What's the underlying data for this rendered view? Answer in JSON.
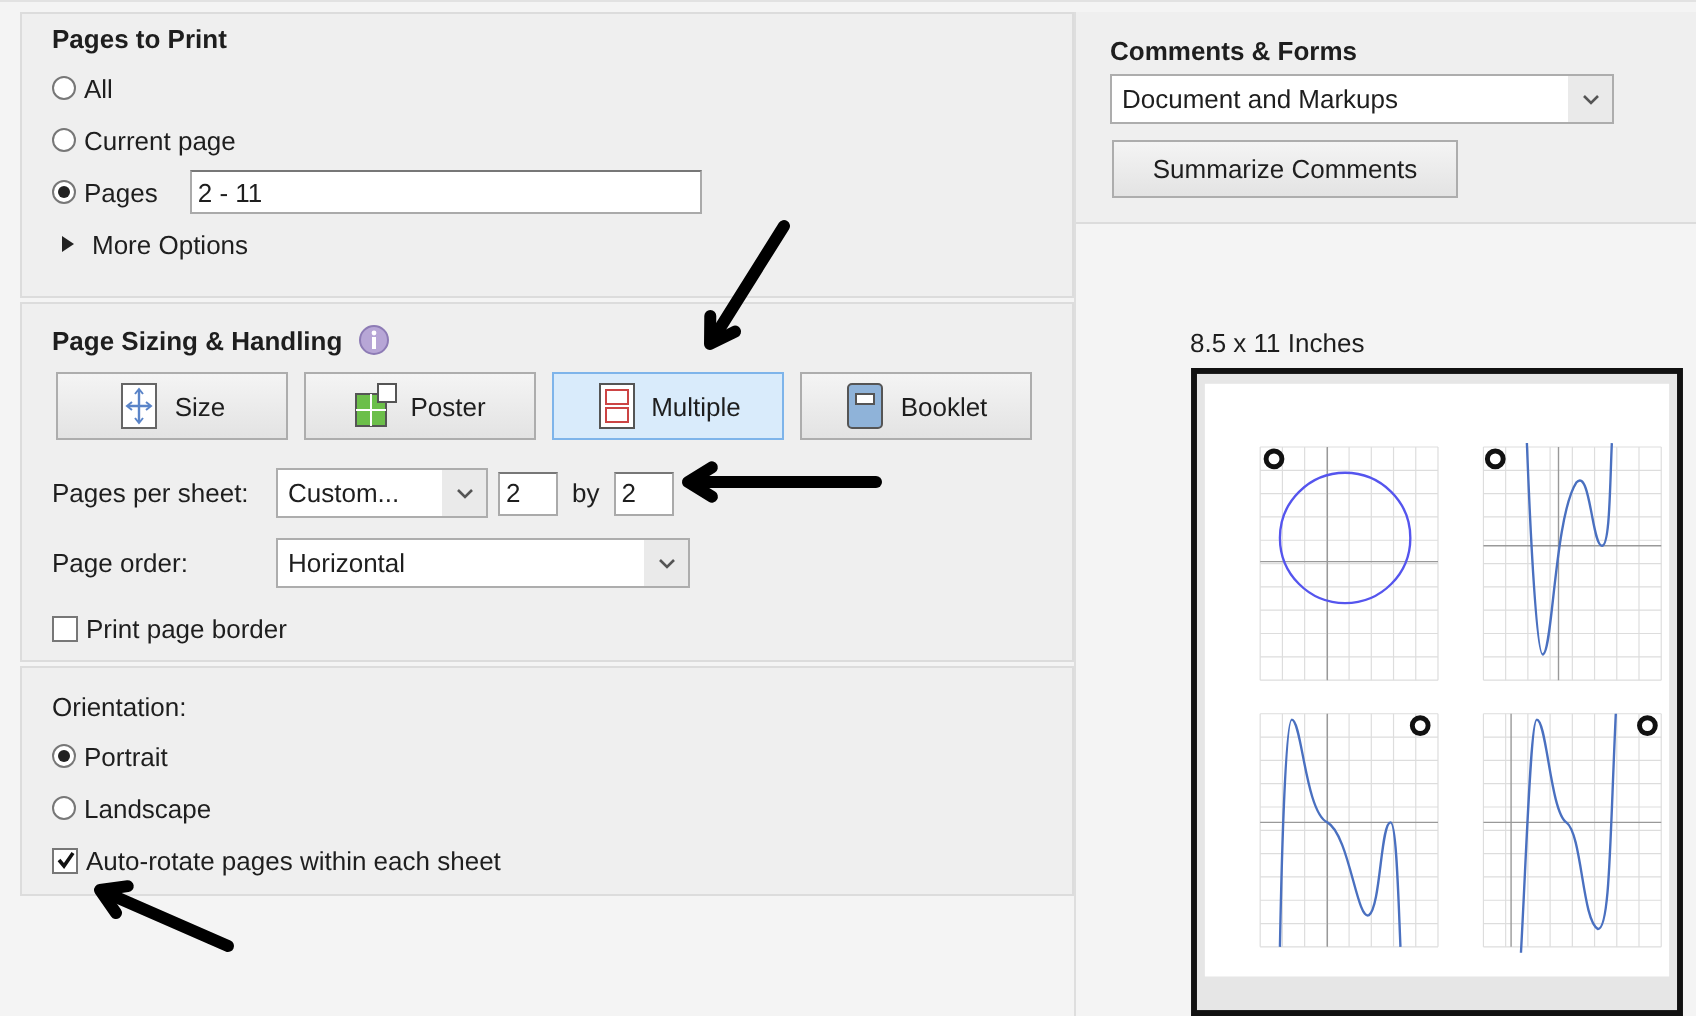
{
  "pages_to_print": {
    "title": "Pages to Print",
    "options": [
      {
        "label": "All",
        "selected": false
      },
      {
        "label": "Current page",
        "selected": false
      },
      {
        "label": "Pages",
        "selected": true,
        "value": "2 - 11"
      }
    ],
    "more_options": {
      "label": "More Options",
      "expanded": false
    }
  },
  "page_sizing": {
    "title": "Page Sizing & Handling",
    "modes": [
      {
        "kind": "size",
        "label": "Size",
        "selected": false
      },
      {
        "kind": "poster",
        "label": "Poster",
        "selected": false
      },
      {
        "kind": "multiple",
        "label": "Multiple",
        "selected": true
      },
      {
        "kind": "booklet",
        "label": "Booklet",
        "selected": false
      }
    ],
    "pages_per_sheet": {
      "label": "Pages per sheet:",
      "preset": "Custom...",
      "columns": "2",
      "by": "by",
      "rows": "2"
    },
    "page_order": {
      "label": "Page order:",
      "value": "Horizontal"
    },
    "print_page_border": {
      "label": "Print page border",
      "checked": false
    }
  },
  "orientation": {
    "title": "Orientation:",
    "options": [
      {
        "label": "Portrait",
        "selected": true
      },
      {
        "label": "Landscape",
        "selected": false
      }
    ],
    "auto_rotate": {
      "label": "Auto-rotate pages within each sheet",
      "checked": true
    }
  },
  "comments_forms": {
    "title": "Comments & Forms",
    "value": "Document and Markups",
    "button": "Summarize Comments"
  },
  "preview": {
    "paper_size": "8.5 x 11 Inches"
  }
}
